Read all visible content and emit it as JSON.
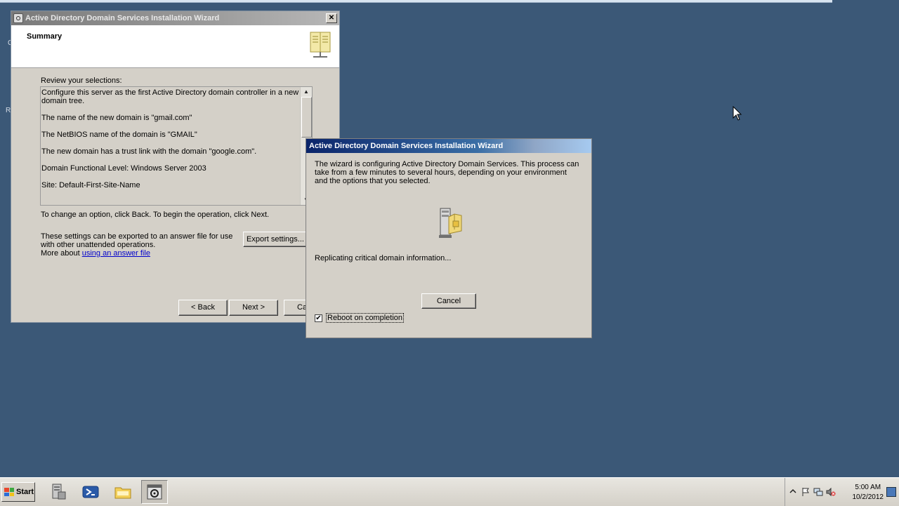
{
  "wizard": {
    "title": "Active Directory Domain Services Installation Wizard",
    "close_label": "✕",
    "header_title": "Summary",
    "review_label": "Review your selections:",
    "review_lines": [
      "Configure this server as the first Active Directory domain controller in a new domain tree.",
      "The name of the new domain is \"gmail.com\"",
      "The NetBIOS name of the domain is \"GMAIL\"",
      "The new domain has a trust link with the domain \"google.com\".",
      "Domain Functional Level: Windows Server 2003",
      "Site: Default-First-Site-Name"
    ],
    "change_text": "To change an option, click Back. To begin the operation, click Next.",
    "export_text": "These settings can be exported to an answer file for use with other unattended operations.",
    "more_about": "More about",
    "answer_file_link": "using an answer file",
    "export_button": "Export settings...",
    "back_button": "< Back",
    "next_button": "Next >",
    "cancel_button": "Ca"
  },
  "progress": {
    "title": "Active Directory Domain Services Installation Wizard",
    "message": "The wizard is configuring Active Directory Domain Services. This process can take from a few minutes to several hours, depending on your environment and the options that you selected.",
    "status": "Replicating critical domain information...",
    "cancel_button": "Cancel",
    "reboot_label": "Reboot on completion",
    "reboot_checked": true,
    "check_glyph": "✔"
  },
  "desktop_fragments": [
    "C",
    "R"
  ],
  "taskbar": {
    "start_label": "Start",
    "apps": [
      "server-manager-icon",
      "powershell-icon",
      "explorer-folder-icon",
      "ad-wizard-icon"
    ],
    "clock_time": "5:00 AM",
    "clock_date": "10/2/2012"
  }
}
